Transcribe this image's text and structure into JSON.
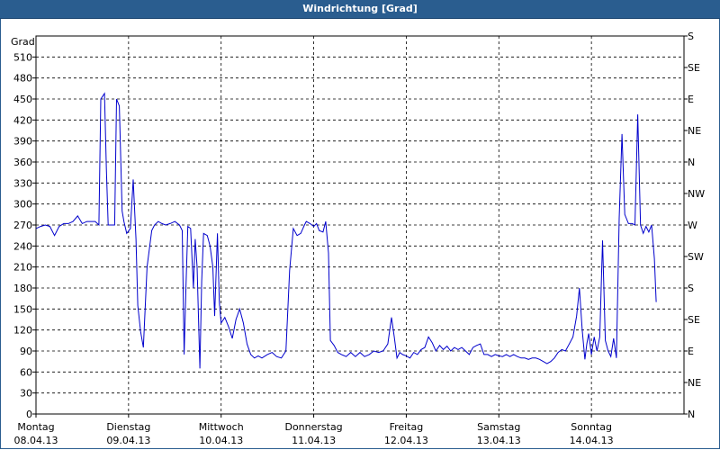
{
  "window": {
    "title": "Windrichtung [Grad]"
  },
  "chart_data": {
    "type": "line",
    "title": "Windrichtung [Grad]",
    "ylabel": "Grad",
    "xlabel": "",
    "ylim": [
      0,
      540
    ],
    "y_ticks": [
      0,
      30,
      60,
      90,
      120,
      150,
      180,
      210,
      240,
      270,
      300,
      330,
      360,
      390,
      420,
      450,
      480,
      510
    ],
    "right_axis_labels": [
      {
        "y": 0,
        "label": "N"
      },
      {
        "y": 45,
        "label": "NE"
      },
      {
        "y": 90,
        "label": "E"
      },
      {
        "y": 135,
        "label": "SE"
      },
      {
        "y": 180,
        "label": "S"
      },
      {
        "y": 225,
        "label": "SW"
      },
      {
        "y": 270,
        "label": "W"
      },
      {
        "y": 315,
        "label": "NW"
      },
      {
        "y": 360,
        "label": "N"
      },
      {
        "y": 405,
        "label": "NE"
      },
      {
        "y": 450,
        "label": "E"
      },
      {
        "y": 495,
        "label": "SE"
      },
      {
        "y": 540,
        "label": "S"
      }
    ],
    "xlim": [
      0,
      7
    ],
    "x_unit": "days",
    "x_ticks": [
      {
        "x": 0,
        "day": "Montag",
        "date": "08.04.13"
      },
      {
        "x": 1,
        "day": "Dienstag",
        "date": "09.04.13"
      },
      {
        "x": 2,
        "day": "Mittwoch",
        "date": "10.04.13"
      },
      {
        "x": 3,
        "day": "Donnerstag",
        "date": "11.04.13"
      },
      {
        "x": 4,
        "day": "Freitag",
        "date": "12.04.13"
      },
      {
        "x": 5,
        "day": "Samstag",
        "date": "13.04.13"
      },
      {
        "x": 6,
        "day": "Sonntag",
        "date": "14.04.13"
      }
    ],
    "grid": true,
    "colors": {
      "line": "#0000cc",
      "grid": "#000000",
      "title_bar": "#2a5d8f"
    },
    "series": [
      {
        "name": "",
        "points": [
          [
            0.0,
            265
          ],
          [
            0.05,
            268
          ],
          [
            0.1,
            270
          ],
          [
            0.15,
            268
          ],
          [
            0.2,
            255
          ],
          [
            0.25,
            268
          ],
          [
            0.3,
            272
          ],
          [
            0.35,
            272
          ],
          [
            0.4,
            275
          ],
          [
            0.45,
            283
          ],
          [
            0.5,
            272
          ],
          [
            0.55,
            275
          ],
          [
            0.6,
            275
          ],
          [
            0.64,
            275
          ],
          [
            0.68,
            270
          ],
          [
            0.7,
            450
          ],
          [
            0.74,
            458
          ],
          [
            0.76,
            350
          ],
          [
            0.78,
            270
          ],
          [
            0.82,
            270
          ],
          [
            0.85,
            270
          ],
          [
            0.87,
            450
          ],
          [
            0.9,
            440
          ],
          [
            0.93,
            290
          ],
          [
            0.95,
            275
          ],
          [
            0.98,
            258
          ],
          [
            1.02,
            265
          ],
          [
            1.05,
            335
          ],
          [
            1.08,
            250
          ],
          [
            1.1,
            155
          ],
          [
            1.13,
            118
          ],
          [
            1.16,
            95
          ],
          [
            1.2,
            210
          ],
          [
            1.25,
            262
          ],
          [
            1.28,
            270
          ],
          [
            1.32,
            275
          ],
          [
            1.36,
            272
          ],
          [
            1.4,
            270
          ],
          [
            1.45,
            272
          ],
          [
            1.5,
            275
          ],
          [
            1.55,
            270
          ],
          [
            1.58,
            262
          ],
          [
            1.6,
            85
          ],
          [
            1.62,
            180
          ],
          [
            1.64,
            268
          ],
          [
            1.67,
            265
          ],
          [
            1.7,
            180
          ],
          [
            1.72,
            250
          ],
          [
            1.74,
            210
          ],
          [
            1.77,
            65
          ],
          [
            1.79,
            190
          ],
          [
            1.81,
            258
          ],
          [
            1.85,
            255
          ],
          [
            1.88,
            240
          ],
          [
            1.91,
            210
          ],
          [
            1.93,
            140
          ],
          [
            1.96,
            258
          ],
          [
            1.98,
            160
          ],
          [
            2.0,
            130
          ],
          [
            2.04,
            138
          ],
          [
            2.08,
            125
          ],
          [
            2.12,
            108
          ],
          [
            2.16,
            135
          ],
          [
            2.2,
            150
          ],
          [
            2.24,
            130
          ],
          [
            2.28,
            100
          ],
          [
            2.32,
            85
          ],
          [
            2.36,
            80
          ],
          [
            2.4,
            83
          ],
          [
            2.44,
            80
          ],
          [
            2.5,
            85
          ],
          [
            2.55,
            88
          ],
          [
            2.6,
            82
          ],
          [
            2.65,
            80
          ],
          [
            2.7,
            90
          ],
          [
            2.74,
            205
          ],
          [
            2.78,
            265
          ],
          [
            2.82,
            255
          ],
          [
            2.86,
            258
          ],
          [
            2.9,
            270
          ],
          [
            2.92,
            275
          ],
          [
            2.96,
            272
          ],
          [
            3.0,
            268
          ],
          [
            3.03,
            272
          ],
          [
            3.06,
            262
          ],
          [
            3.1,
            260
          ],
          [
            3.13,
            275
          ],
          [
            3.16,
            230
          ],
          [
            3.18,
            105
          ],
          [
            3.22,
            98
          ],
          [
            3.26,
            88
          ],
          [
            3.3,
            85
          ],
          [
            3.35,
            82
          ],
          [
            3.4,
            88
          ],
          [
            3.45,
            82
          ],
          [
            3.5,
            88
          ],
          [
            3.55,
            82
          ],
          [
            3.6,
            85
          ],
          [
            3.65,
            90
          ],
          [
            3.7,
            88
          ],
          [
            3.75,
            90
          ],
          [
            3.8,
            100
          ],
          [
            3.84,
            138
          ],
          [
            3.87,
            110
          ],
          [
            3.9,
            80
          ],
          [
            3.93,
            88
          ],
          [
            3.96,
            85
          ],
          [
            4.0,
            83
          ],
          [
            4.04,
            80
          ],
          [
            4.08,
            88
          ],
          [
            4.12,
            85
          ],
          [
            4.16,
            92
          ],
          [
            4.2,
            95
          ],
          [
            4.24,
            110
          ],
          [
            4.28,
            102
          ],
          [
            4.32,
            90
          ],
          [
            4.36,
            98
          ],
          [
            4.4,
            92
          ],
          [
            4.44,
            97
          ],
          [
            4.48,
            90
          ],
          [
            4.52,
            95
          ],
          [
            4.56,
            92
          ],
          [
            4.6,
            95
          ],
          [
            4.64,
            90
          ],
          [
            4.68,
            85
          ],
          [
            4.72,
            95
          ],
          [
            4.76,
            98
          ],
          [
            4.8,
            100
          ],
          [
            4.84,
            85
          ],
          [
            4.88,
            85
          ],
          [
            4.92,
            82
          ],
          [
            4.96,
            85
          ],
          [
            5.0,
            83
          ],
          [
            5.04,
            82
          ],
          [
            5.08,
            85
          ],
          [
            5.12,
            82
          ],
          [
            5.16,
            85
          ],
          [
            5.2,
            82
          ],
          [
            5.24,
            80
          ],
          [
            5.28,
            80
          ],
          [
            5.32,
            78
          ],
          [
            5.36,
            80
          ],
          [
            5.4,
            80
          ],
          [
            5.44,
            78
          ],
          [
            5.48,
            75
          ],
          [
            5.52,
            72
          ],
          [
            5.56,
            75
          ],
          [
            5.6,
            80
          ],
          [
            5.64,
            88
          ],
          [
            5.68,
            92
          ],
          [
            5.72,
            90
          ],
          [
            5.76,
            100
          ],
          [
            5.8,
            110
          ],
          [
            5.84,
            140
          ],
          [
            5.87,
            180
          ],
          [
            5.9,
            120
          ],
          [
            5.93,
            78
          ],
          [
            5.95,
            100
          ],
          [
            5.97,
            115
          ],
          [
            6.0,
            85
          ],
          [
            6.03,
            110
          ],
          [
            6.06,
            90
          ],
          [
            6.09,
            110
          ],
          [
            6.12,
            248
          ],
          [
            6.15,
            105
          ],
          [
            6.18,
            90
          ],
          [
            6.21,
            82
          ],
          [
            6.24,
            108
          ],
          [
            6.27,
            80
          ],
          [
            6.3,
            280
          ],
          [
            6.33,
            400
          ],
          [
            6.36,
            285
          ],
          [
            6.4,
            272
          ],
          [
            6.44,
            272
          ],
          [
            6.47,
            270
          ],
          [
            6.5,
            428
          ],
          [
            6.53,
            270
          ],
          [
            6.56,
            258
          ],
          [
            6.59,
            268
          ],
          [
            6.62,
            260
          ],
          [
            6.65,
            270
          ],
          [
            6.68,
            222
          ],
          [
            6.7,
            160
          ]
        ]
      }
    ]
  }
}
